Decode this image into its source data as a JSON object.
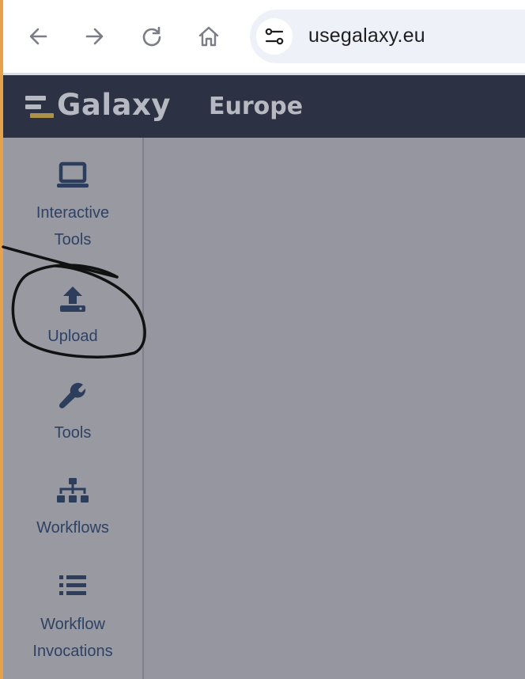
{
  "browser": {
    "url": "usegalaxy.eu",
    "back_icon": "arrow-left-icon",
    "forward_icon": "arrow-right-icon",
    "reload_icon": "reload-icon",
    "home_icon": "home-icon",
    "site_info_icon": "tune-icon"
  },
  "masthead": {
    "brand": "Galaxy",
    "subtitle": "Europe",
    "background": "#2c3143"
  },
  "sidebar": {
    "items": [
      {
        "label_lines": [
          "Interactive",
          "Tools"
        ],
        "icon": "laptop-icon"
      },
      {
        "label_lines": [
          "Upload"
        ],
        "icon": "upload-icon"
      },
      {
        "label_lines": [
          "Tools"
        ],
        "icon": "wrench-icon"
      },
      {
        "label_lines": [
          "Workflows"
        ],
        "icon": "sitemap-icon"
      },
      {
        "label_lines": [
          "Workflow",
          "Invocations"
        ],
        "icon": "list-icon"
      }
    ]
  },
  "colors": {
    "accent": "#2f4264",
    "overlay": "#95969f"
  }
}
